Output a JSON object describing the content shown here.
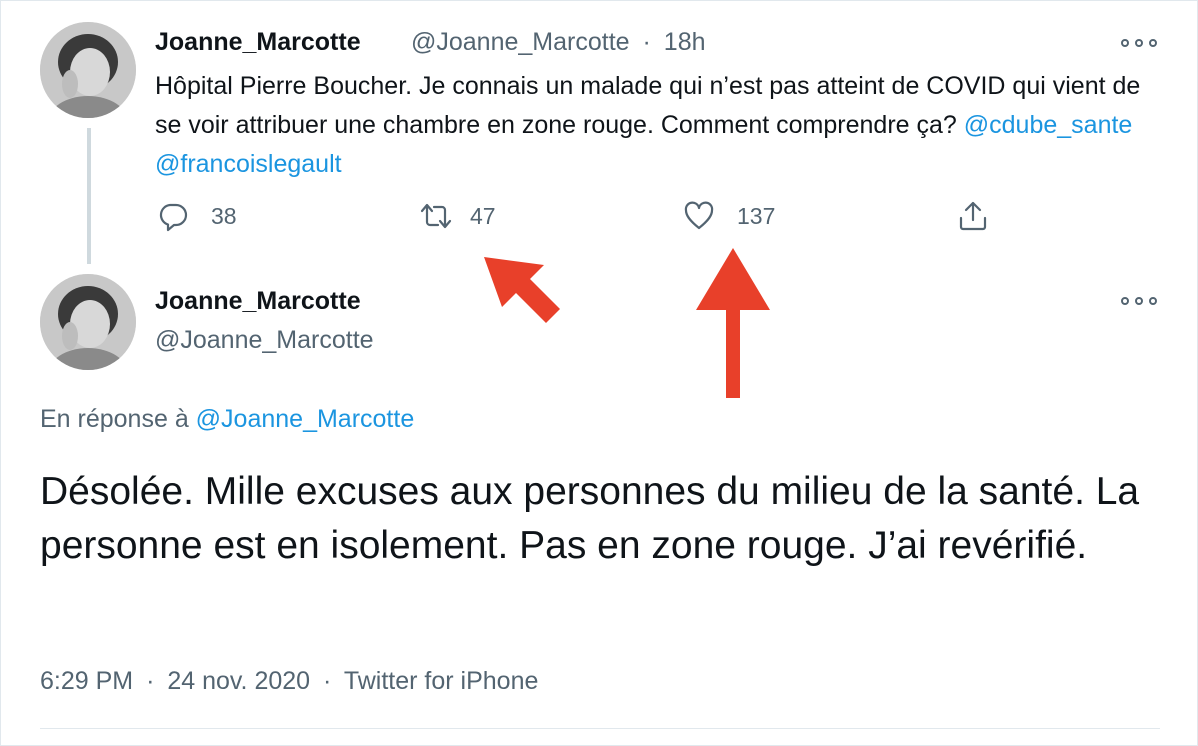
{
  "original_tweet": {
    "author_name": "Joanne_Marcotte",
    "author_handle": "@Joanne_Marcotte",
    "separator": "·",
    "age": "18h",
    "text": "Hôpital Pierre Boucher. Je connais un malade qui n’est pas atteint de COVID qui vient de se voir attribuer une chambre en zone rouge. Comment comprendre ça? ",
    "mention_1": "@cdube_sante",
    "mention_2": "@francoislegault",
    "actions": {
      "reply_count": "38",
      "retweet_count": "47",
      "like_count": "137"
    }
  },
  "reply_tweet": {
    "author_name": "Joanne_Marcotte",
    "author_handle": "@Joanne_Marcotte",
    "reply_prefix": "En réponse à",
    "reply_handle": "@Joanne_Marcotte",
    "text": "Désolée. Mille excuses aux personnes du milieu de la santé. La personne est en isolement. Pas en zone rouge. J’ai revérifié.",
    "time": "6:29 PM",
    "date": "24 nov. 2020",
    "separator": "·",
    "source": "Twitter for iPhone"
  },
  "icons": [
    "more-icon",
    "reply-icon",
    "retweet-icon",
    "like-icon",
    "share-icon",
    "arrow-annotation"
  ],
  "colors": {
    "link": "#1b95e0",
    "secondary_text": "#536471",
    "annotation_arrow": "#e8402a"
  }
}
